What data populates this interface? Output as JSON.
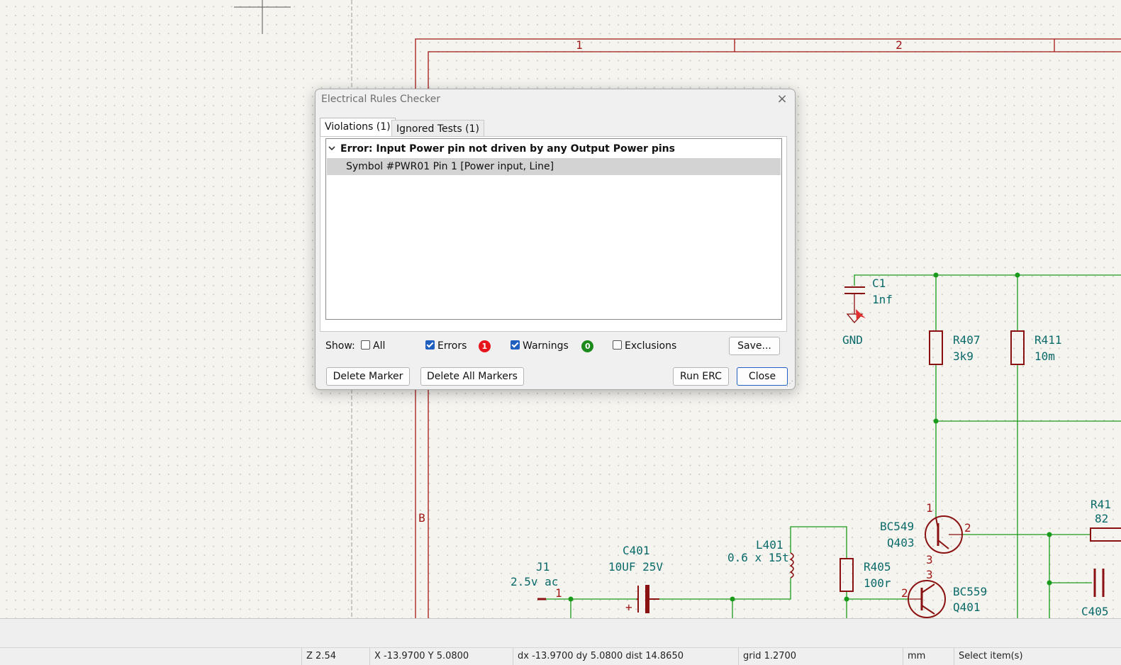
{
  "dialog": {
    "title": "Electrical Rules Checker",
    "close_glyph": "×",
    "tabs": [
      {
        "label": "Violations (1)",
        "selected": true
      },
      {
        "label": "Ignored Tests (1)",
        "selected": false
      }
    ],
    "violations": [
      {
        "group": "Error: Input Power pin not driven by any Output Power pins",
        "expanded": true,
        "items": [
          "Symbol #PWR01 Pin 1 [Power input, Line]"
        ]
      }
    ],
    "show_label": "Show:",
    "filters": {
      "all": {
        "label": "All",
        "checked": false
      },
      "errors": {
        "label": "Errors",
        "checked": true,
        "count": "1",
        "color": "#e8141c"
      },
      "warnings": {
        "label": "Warnings",
        "checked": true,
        "count": "0",
        "color": "#1d8a1d"
      },
      "exclusions": {
        "label": "Exclusions",
        "checked": false
      }
    },
    "buttons": {
      "save": "Save...",
      "delete_marker": "Delete Marker",
      "delete_all_markers": "Delete All Markers",
      "run_erc": "Run ERC",
      "close": "Close"
    }
  },
  "statusbar": {
    "zoom": "Z 2.54",
    "position": "X -13.9700  Y 5.0800",
    "delta": "dx -13.9700  dy 5.0800  dist 14.8650",
    "grid": "grid 1.2700",
    "units": "mm",
    "mode": "Select item(s)"
  },
  "schematic": {
    "colors": {
      "wire": "#1a9a1a",
      "component": "#8a1111",
      "reference": "#0a6a6a",
      "sheet_border": "#a01818"
    },
    "border_labels": {
      "col1": "1",
      "col2": "2",
      "row_b": "B"
    },
    "components": {
      "c1": {
        "ref": "C1",
        "value": "1nf"
      },
      "gnd": {
        "label": "GND"
      },
      "r407": {
        "ref": "R407",
        "value": "3k9"
      },
      "r411": {
        "ref": "R411",
        "value": "10m"
      },
      "r41x": {
        "ref": "R41",
        "value": "82"
      },
      "q403": {
        "part": "BC549",
        "ref": "Q403",
        "pin_base": "2",
        "pin_collector": "1",
        "pin_emitter": "3"
      },
      "q401": {
        "part": "BC559",
        "ref": "Q401",
        "pin_base": "2",
        "pin_3": "3"
      },
      "l401": {
        "ref": "L401",
        "value": "0.6 x 15t"
      },
      "r405": {
        "ref": "R405",
        "value": "100r"
      },
      "c401": {
        "ref": "C401",
        "value": "10UF 25V",
        "polarity": "+"
      },
      "j1": {
        "ref": "J1",
        "value": "2.5v ac",
        "pin": "1"
      },
      "c405": {
        "ref": "C405"
      }
    }
  }
}
